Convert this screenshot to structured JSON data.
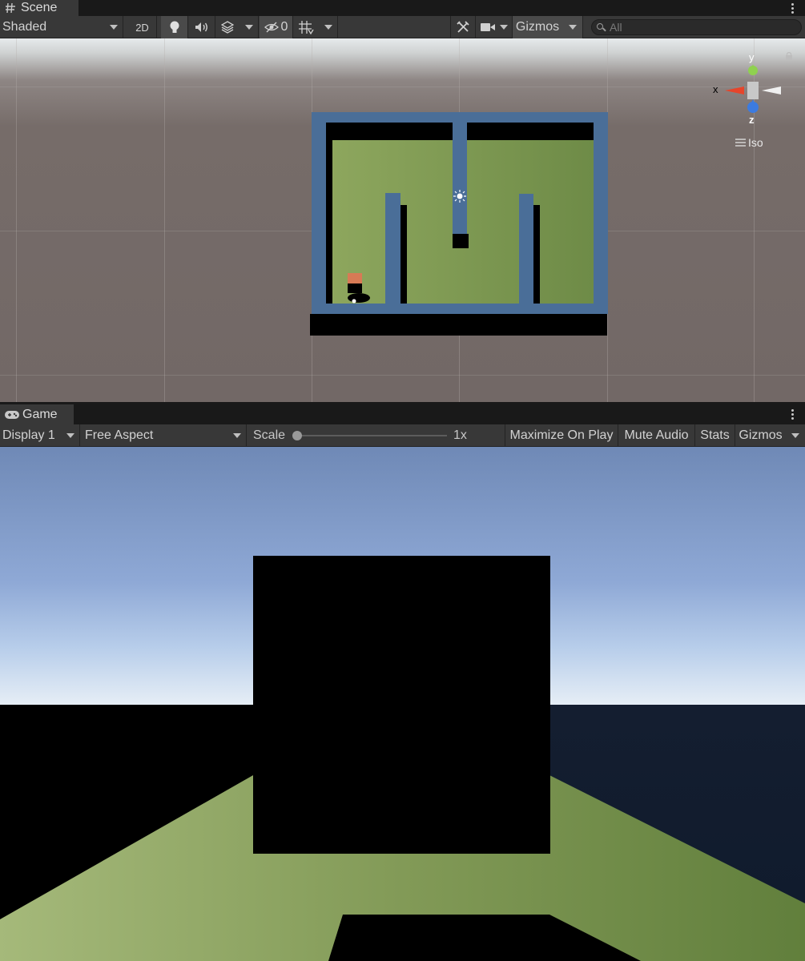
{
  "scene_panel": {
    "tab_label": "Scene",
    "toolbar": {
      "draw_mode": "Shaded",
      "mode_2d": "2D",
      "hidden_count": "0",
      "gizmos_label": "Gizmos",
      "search_placeholder": "All"
    },
    "orientation_gizmo": {
      "axis_x": "x",
      "axis_y": "y",
      "axis_z": "z",
      "projection_label": "Iso"
    }
  },
  "game_panel": {
    "tab_label": "Game",
    "toolbar": {
      "display": "Display 1",
      "aspect": "Free Aspect",
      "scale_label": "Scale",
      "scale_value": "1x",
      "maximize_on_play": "Maximize On Play",
      "mute_audio": "Mute Audio",
      "stats": "Stats",
      "gizmos_label": "Gizmos"
    }
  },
  "colors": {
    "editor_bg": "#383838",
    "wall_blue": "#4a6e98",
    "floor_green": "#7f9c56",
    "player_orange": "#d77a55",
    "sky_blue": "#7e98c6"
  },
  "icons": [
    "hash-icon",
    "lightbulb-icon",
    "audio-icon",
    "effects-icon",
    "visibility-icon",
    "grid-snap-icon",
    "tools-icon",
    "camera-icon",
    "search-icon",
    "lock-icon",
    "gamepad-icon",
    "kebab-menu-icon"
  ]
}
